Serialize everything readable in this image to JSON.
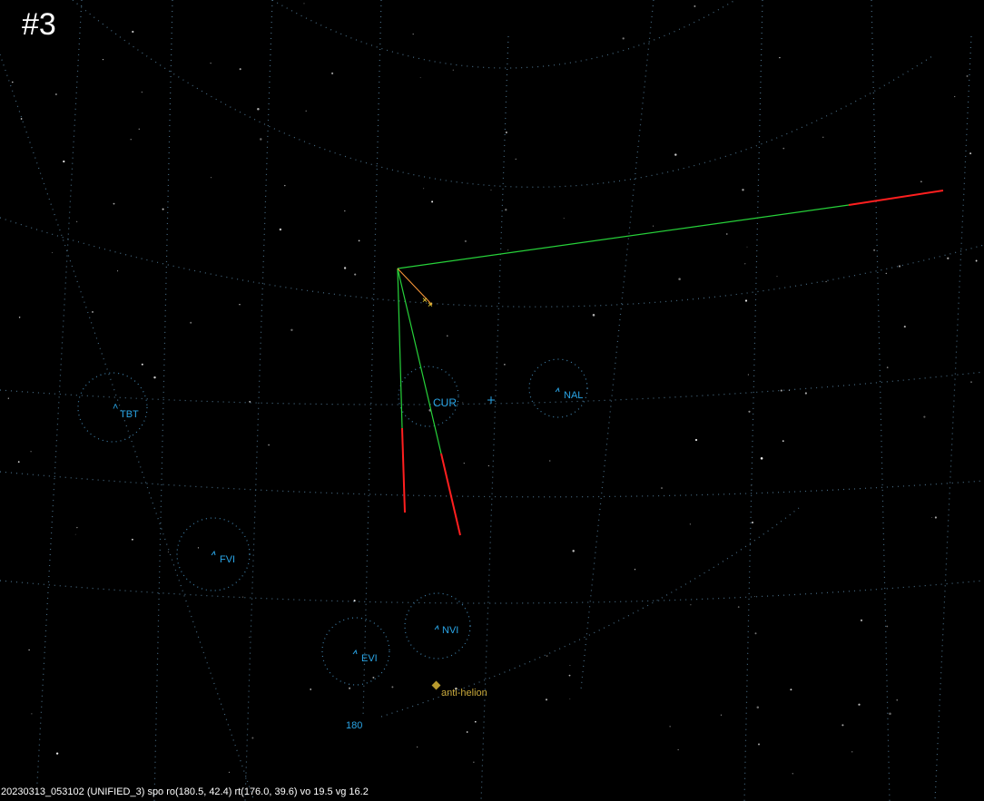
{
  "panel_number": "#3",
  "footer_caption": "20230313_053102 (UNIFIED_3) spo ro(180.5, 42.4) rt(176.0, 39.6) vo 19.5 vg 16.2",
  "cameras": {
    "tbt": "TBT",
    "cur": "CUR",
    "nal": "NAL",
    "fvi": "FVI",
    "nvi": "NVI",
    "evi": "EVI"
  },
  "anti_helion_label": "anti-helion",
  "azimuth_label": "180",
  "colors": {
    "background": "#000000",
    "track_green": "#27d23a",
    "track_red": "#ff1f1f",
    "camera_label": "#2aa5e6",
    "anti_helion": "#c8a83a"
  }
}
